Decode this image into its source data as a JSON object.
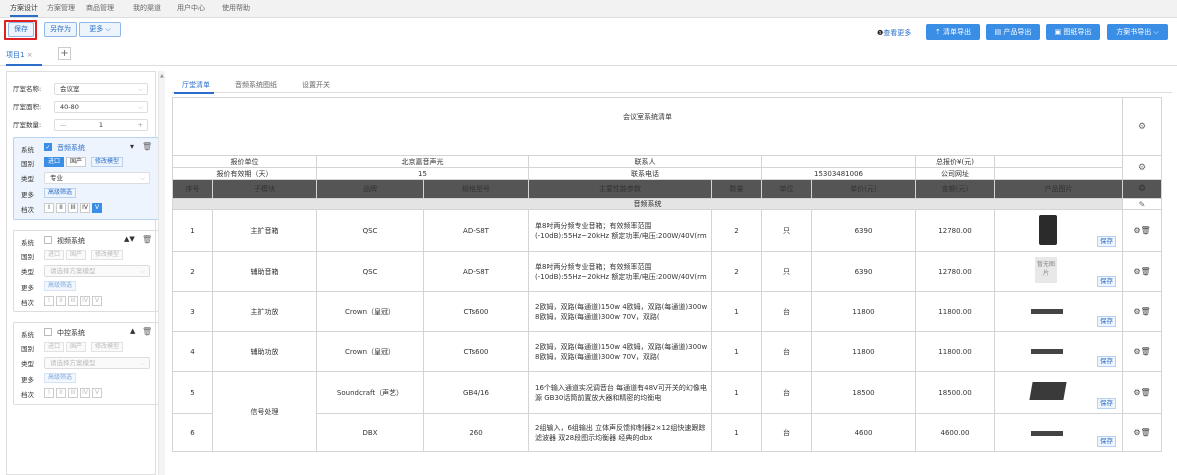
{
  "menu": [
    "方案设计",
    "方案管理",
    "商品管理",
    "我的渠道",
    "用户中心",
    "使用帮助"
  ],
  "toolbar": {
    "save": "保存",
    "save_as": "另存为",
    "more": "更多",
    "view_more": "查看更多",
    "exports": [
      "清单导出",
      "产品导出",
      "图纸导出",
      "方案书导出"
    ]
  },
  "project_tab": "项目1",
  "hall": {
    "name_label": "厅室名称:",
    "name_value": "会议室",
    "area_label": "厅室面积:",
    "area_value": "40-80",
    "count_label": "厅室数量:",
    "count_value": "1"
  },
  "systems": [
    {
      "name": "音频系统",
      "checked": true,
      "scene": "进口",
      "scene_alt": "国产",
      "edit": "修改模型",
      "type": "专业",
      "type_placeholder": "",
      "advanced": "高级筛选",
      "levels": [
        "I",
        "II",
        "III",
        "IV",
        "V"
      ]
    },
    {
      "name": "视频系统",
      "checked": false,
      "scene": "进口",
      "scene_alt": "国产",
      "edit": "修改模型",
      "type": "",
      "type_placeholder": "请选择方案模型",
      "advanced": "高级筛选",
      "levels": [
        "I",
        "II",
        "III",
        "IV",
        "V"
      ]
    },
    {
      "name": "中控系统",
      "checked": false,
      "scene": "进口",
      "scene_alt": "国产",
      "edit": "修改模型",
      "type": "",
      "type_placeholder": "请选择方案模型",
      "advanced": "高级筛选",
      "levels": [
        "I",
        "II",
        "III",
        "IV",
        "V"
      ]
    }
  ],
  "labels": {
    "system": "系统",
    "scene": "国别",
    "type": "类型",
    "more": "更多",
    "level": "档次"
  },
  "right_tabs": [
    "厅堂清单",
    "音频系统图纸",
    "设置开关"
  ],
  "table": {
    "title": "会议室系统清单",
    "quote_unit_label": "报价单位",
    "quote_unit_value": "北京嘉音声光",
    "contact_label": "联系人",
    "contact_value": "",
    "total_label": "总报价¥(元)",
    "valid_label": "报价有效期（天）",
    "valid_value": "15",
    "phone_label": "联系电话",
    "phone_value": "15303481006",
    "site_label": "公司网址",
    "headers": [
      "序号",
      "子模块",
      "品牌",
      "规格型号",
      "主要性能参数",
      "数量",
      "单位",
      "单价(元)",
      "金额(元)",
      "产品图片"
    ],
    "category": "音频系统",
    "save_badge": "保存",
    "no_image": "暂无图片",
    "rows": [
      {
        "no": "1",
        "module": "主扩音箱",
        "brand": "QSC",
        "model": "AD-S8T",
        "desc": "单8吋两分频专业音箱；有效频率范围(-10dB):55Hz~20kHz 额定功率/电压:200W/40V(rm",
        "qty": "2",
        "unit": "只",
        "price": "6390",
        "amount": "12780.00",
        "img": "speaker"
      },
      {
        "no": "2",
        "module": "辅助音箱",
        "brand": "QSC",
        "model": "AD-S8T",
        "desc": "单8吋两分频专业音箱；有效频率范围(-10dB):55Hz~20kHz 额定功率/电压:200W/40V(rm",
        "qty": "2",
        "unit": "只",
        "price": "6390",
        "amount": "12780.00",
        "img": "none"
      },
      {
        "no": "3",
        "module": "主扩功放",
        "brand": "Crown（皇冠）",
        "model": "CTs600",
        "desc": "2欧姆，双路(每通道)150w 4欧姆，双路(每通道)300w 8欧姆，双路(每通道)300w 70V，双路(",
        "qty": "1",
        "unit": "台",
        "price": "11800",
        "amount": "11800.00",
        "img": "rack"
      },
      {
        "no": "4",
        "module": "辅助功放",
        "brand": "Crown（皇冠）",
        "model": "CTs600",
        "desc": "2欧姆，双路(每通道)150w 4欧姆，双路(每通道)300w 8欧姆，双路(每通道)300w 70V，双路(",
        "qty": "1",
        "unit": "台",
        "price": "11800",
        "amount": "11800.00",
        "img": "rack"
      },
      {
        "no": "5",
        "module": "",
        "brand": "Soundcraft（声艺）",
        "model": "GB4/16",
        "desc": "16个输入通道实况调音台 每通道有48V可开关的幻像电源 GB30话筒前置放大器和精密的均衡电",
        "qty": "1",
        "unit": "台",
        "price": "18500",
        "amount": "18500.00",
        "img": "mixer"
      },
      {
        "no": "6",
        "module": "信号处理",
        "brand": "DBX",
        "model": "260",
        "desc": "2组输入，6组输出 立体声反馈抑制器2×12组快速跟踪滤波器 双28段图示均衡器 经典的dbx",
        "qty": "1",
        "unit": "台",
        "price": "4600",
        "amount": "4600.00",
        "img": "rack"
      }
    ]
  }
}
